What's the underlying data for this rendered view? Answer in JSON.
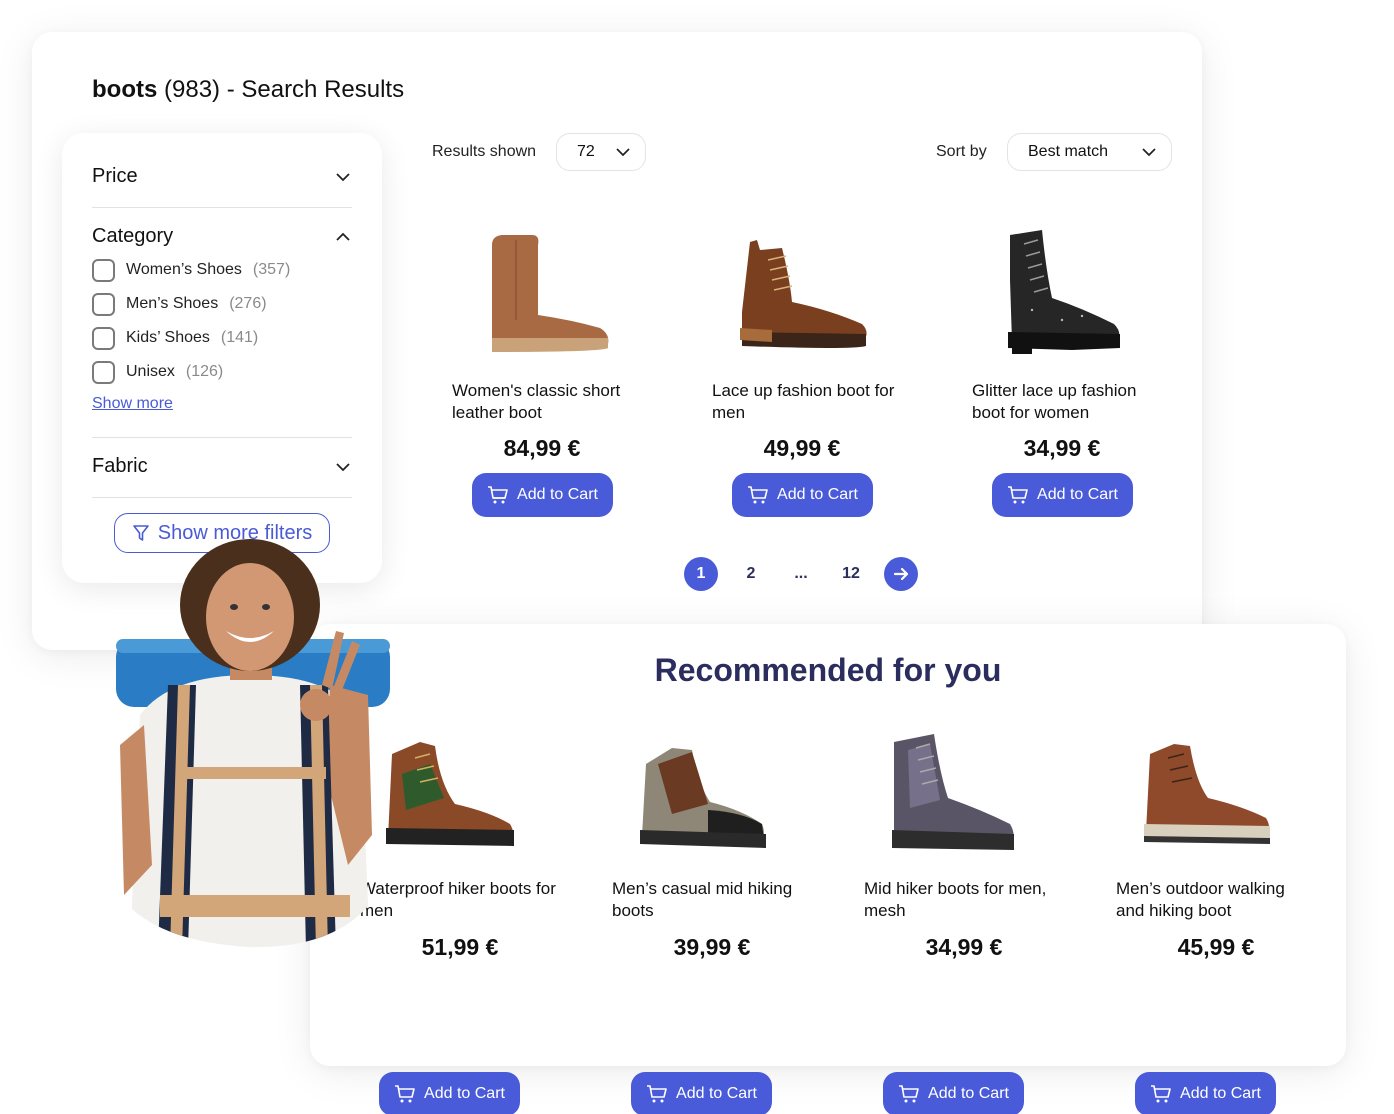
{
  "header": {
    "query": "boots",
    "count_text": "(983)",
    "suffix": "- Search Results"
  },
  "filters": {
    "price": {
      "label": "Price",
      "state": "collapsed"
    },
    "category": {
      "label": "Category",
      "state": "expanded",
      "options": [
        {
          "label": "Women’s Shoes",
          "count": "(357)",
          "checked": false
        },
        {
          "label": "Men’s Shoes",
          "count": "(276)",
          "checked": false
        },
        {
          "label": "Kids’ Shoes",
          "count": "(141)",
          "checked": false
        },
        {
          "label": "Unisex",
          "count": "(126)",
          "checked": false
        }
      ],
      "show_more": "Show more"
    },
    "fabric": {
      "label": "Fabric",
      "state": "collapsed"
    },
    "more_filters_label": "Show more filters"
  },
  "toolbar": {
    "results_label": "Results shown",
    "results_value": "72",
    "sort_label": "Sort by",
    "sort_value": "Best match"
  },
  "products": [
    {
      "name": "Women's classic short leather boot",
      "price": "84,99 €",
      "button": "Add to Cart",
      "image": "tan-suede-boot"
    },
    {
      "name": "Lace up fashion boot for men",
      "price": "49,99 €",
      "button": "Add to Cart",
      "image": "brown-leather-lace-boot"
    },
    {
      "name": "Glitter lace up fashion boot for women",
      "price": "34,99 €",
      "button": "Add to Cart",
      "image": "black-glitter-combat-boot"
    }
  ],
  "pagination": {
    "pages": [
      "1",
      "2",
      "...",
      "12"
    ],
    "current": "1"
  },
  "recommended": {
    "title": "Recommended for you",
    "products": [
      {
        "name": "Waterproof hiker boots for men",
        "price": "51,99 €",
        "button": "Add to Cart",
        "image": "brown-green-hiker-boot"
      },
      {
        "name": "Men’s casual mid hiking boots",
        "price": "39,99 €",
        "button": "Add to Cart",
        "image": "grey-brown-hiking-boot"
      },
      {
        "name": "Mid hiker boots for men, mesh",
        "price": "34,99 €",
        "button": "Add to Cart",
        "image": "purple-grey-mesh-boot"
      },
      {
        "name": "Men’s outdoor walking and hiking boot",
        "price": "45,99 €",
        "button": "Add to Cart",
        "image": "brown-walking-boot"
      }
    ]
  },
  "colors": {
    "accent": "#4a5bd9",
    "heading": "#2a2d5e",
    "link": "#4a5bd4"
  }
}
